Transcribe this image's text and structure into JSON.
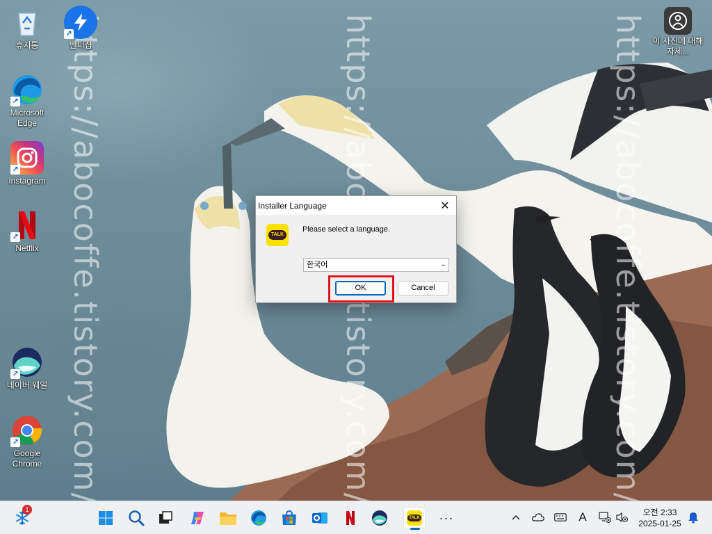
{
  "desktop": {
    "icons": [
      {
        "label": "휴지통",
        "icon": "recycle-bin-icon"
      },
      {
        "label": "반디집",
        "icon": "bandizip-icon"
      },
      {
        "label": "Microsoft Edge",
        "icon": "edge-icon"
      },
      {
        "label": "Instagram",
        "icon": "instagram-icon"
      },
      {
        "label": "Netflix",
        "icon": "netflix-icon"
      },
      {
        "label": "네이버 웨일",
        "icon": "whale-icon"
      },
      {
        "label": "Google Chrome",
        "icon": "chrome-icon"
      },
      {
        "label": "이 사진에 대해 자세...",
        "icon": "learn-about-picture-icon"
      }
    ],
    "watermark": "https://abocoffe.tistory.com/"
  },
  "dialog": {
    "title": "Installer Language",
    "prompt": "Please select a language.",
    "selected_language": "한국어",
    "ok_label": "OK",
    "cancel_label": "Cancel",
    "logo_text": "TALK",
    "highlight_color": "#e4161f"
  },
  "taskbar": {
    "widgets_badge": "1",
    "pinned": [
      "start-icon",
      "search-icon",
      "task-view-icon",
      "copilot-icon",
      "file-explorer-icon",
      "edge-icon",
      "store-icon",
      "outlook-icon",
      "netflix-icon",
      "whale-icon",
      "kakaotalk-icon",
      "more-icon"
    ],
    "active_app": "kakaotalk-icon",
    "kakaotalk_label": "TALK",
    "ime_indicator": "A",
    "clock": {
      "period": "오전",
      "time": "2:33",
      "date": "2025-01-25"
    },
    "accent": "#0067c0"
  }
}
